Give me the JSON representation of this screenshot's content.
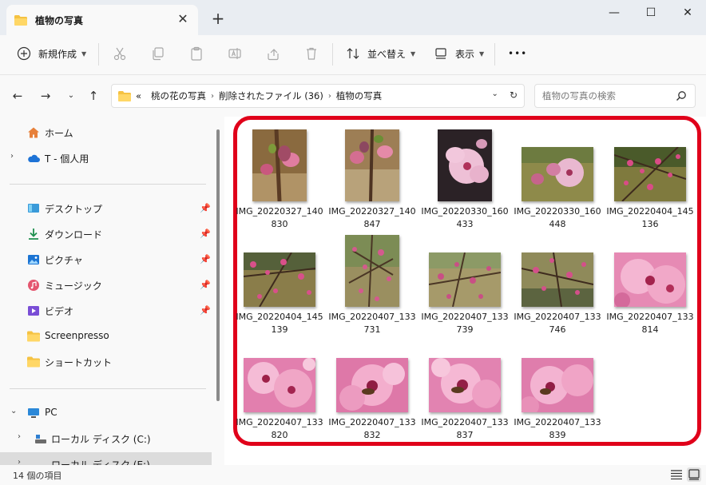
{
  "tab": {
    "title": "植物の写真",
    "close": "✕",
    "new": "+"
  },
  "window": {
    "minimize": "—",
    "maximize": "☐",
    "close": "✕"
  },
  "toolbar": {
    "new_label": "新規作成",
    "sort_label": "並べ替え",
    "view_label": "表示",
    "more_label": "•••"
  },
  "address": {
    "overflow": "«",
    "crumbs": [
      "桃の花の写真",
      "削除されたファイル (36)",
      "植物の写真"
    ]
  },
  "search": {
    "placeholder": "植物の写真の検索"
  },
  "sidebar": {
    "home": "ホーム",
    "onedrive": "T - 個人用",
    "desktop": "デスクトップ",
    "downloads": "ダウンロード",
    "pictures": "ピクチャ",
    "music": "ミュージック",
    "videos": "ビデオ",
    "screenpresso": "Screenpresso",
    "shortcut": "ショートカット",
    "pc": "PC",
    "disk_c": "ローカル ディスク (C:)",
    "disk_e": "ローカル ディスク (E:)"
  },
  "files": [
    "IMG_20220327_140830",
    "IMG_20220327_140847",
    "IMG_20220330_160433",
    "IMG_20220330_160448",
    "IMG_20220404_145136",
    "IMG_20220404_145139",
    "IMG_20220407_133731",
    "IMG_20220407_133739",
    "IMG_20220407_133746",
    "IMG_20220407_133814",
    "IMG_20220407_133820",
    "IMG_20220407_133832",
    "IMG_20220407_133837",
    "IMG_20220407_133839"
  ],
  "status": {
    "count": "14 個の項目"
  },
  "colors": {
    "highlight": "#e0001a",
    "folder": "#f5c242",
    "accent": "#0067c0"
  }
}
